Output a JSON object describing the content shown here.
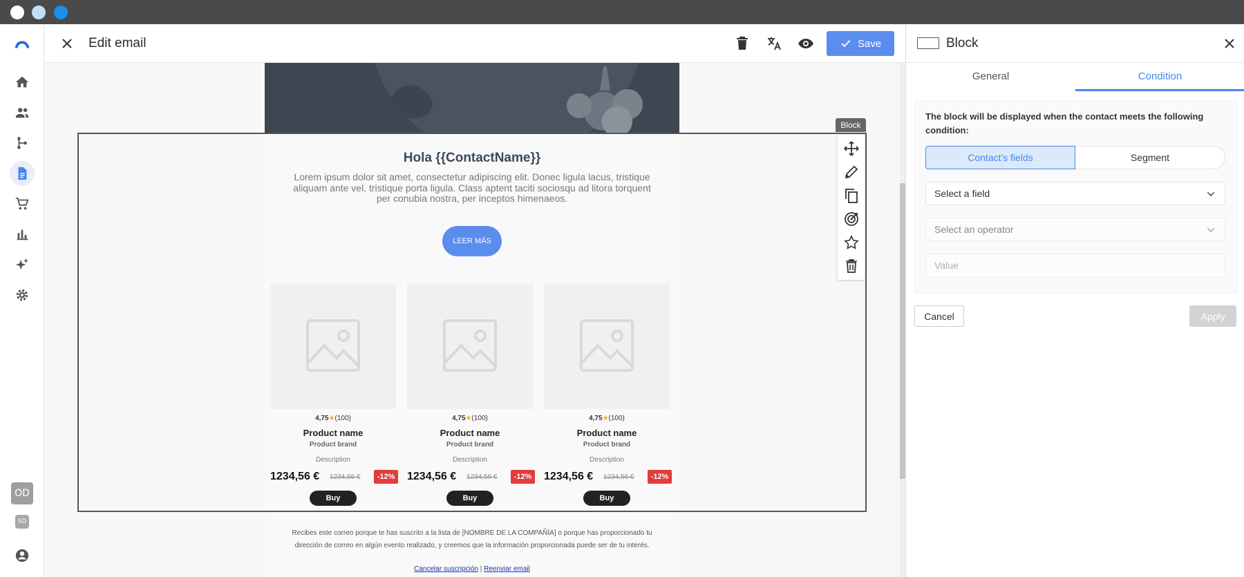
{
  "editor": {
    "title": "Edit email",
    "save_label": "Save"
  },
  "sidebar": {
    "user_initials": "OD",
    "secondary_initials": "SD"
  },
  "canvas": {
    "block_tag": "Block",
    "greeting": "Hola {{ContactName}}",
    "lorem": "Lorem ipsum dolor sit amet, consectetur adipiscing elit. Donec ligula lacus, tristique aliquam ante vel, tristique porta ligula. Class aptent taciti sociosqu ad litora torquent per conubia nostra, per inceptos himenaeos.",
    "cta_label": "LEER MÁS",
    "products": [
      {
        "rating": "4,75",
        "reviews": "(100)",
        "name": "Product name",
        "brand": "Product brand",
        "description": "Description",
        "price": "1234,56 €",
        "old_price": "1234,56 €",
        "discount": "-12%",
        "buy": "Buy"
      },
      {
        "rating": "4,75",
        "reviews": "(100)",
        "name": "Product name",
        "brand": "Product brand",
        "description": "Description",
        "price": "1234,56 €",
        "old_price": "1234,56 €",
        "discount": "-12%",
        "buy": "Buy"
      },
      {
        "rating": "4,75",
        "reviews": "(100)",
        "name": "Product name",
        "brand": "Product brand",
        "description": "Description",
        "price": "1234,56 €",
        "old_price": "1234,56 €",
        "discount": "-12%",
        "buy": "Buy"
      }
    ],
    "footer_text": "Recibes este correo porque te has suscrito a la lista de [NOMBRE DE LA COMPAÑÍA] o porque has proporcionado tu dirección de correo en algún evento realizado, y creemos que la información proporcionada puede ser de tu interés.",
    "unsubscribe": "Cancelar suscripción",
    "separator": "|",
    "forward": "Reenviar email"
  },
  "panel": {
    "title": "Block",
    "tabs": [
      {
        "label": "General",
        "active": false
      },
      {
        "label": "Condition",
        "active": true
      }
    ],
    "description": "The block will be displayed when the contact meets the following condition:",
    "segments": [
      {
        "label": "Contact's fields",
        "active": true
      },
      {
        "label": "Segment",
        "active": false
      }
    ],
    "field_select": "Select a field",
    "operator_select": "Select an operator",
    "value_placeholder": "Value",
    "cancel_label": "Cancel",
    "apply_label": "Apply"
  },
  "colors": {
    "accent": "#4a86e8",
    "save_button": "#5b8def",
    "discount": "#e23b3b",
    "titlebar": "#4a4a4a",
    "nav_icon": "#555555",
    "logo": "#1a6fd8"
  },
  "icons": {
    "nav": [
      "home-icon",
      "people-icon",
      "flow-icon",
      "document-icon",
      "cart-icon",
      "chart-icon",
      "sparkle-icon",
      "gear-icon",
      "account-icon"
    ],
    "header": [
      "close-icon",
      "trash-icon",
      "translate-icon",
      "eye-icon",
      "check-icon"
    ],
    "block_toolbar": [
      "move-icon",
      "pencil-icon",
      "copy-icon",
      "target-icon",
      "star-icon",
      "delete-icon"
    ]
  }
}
